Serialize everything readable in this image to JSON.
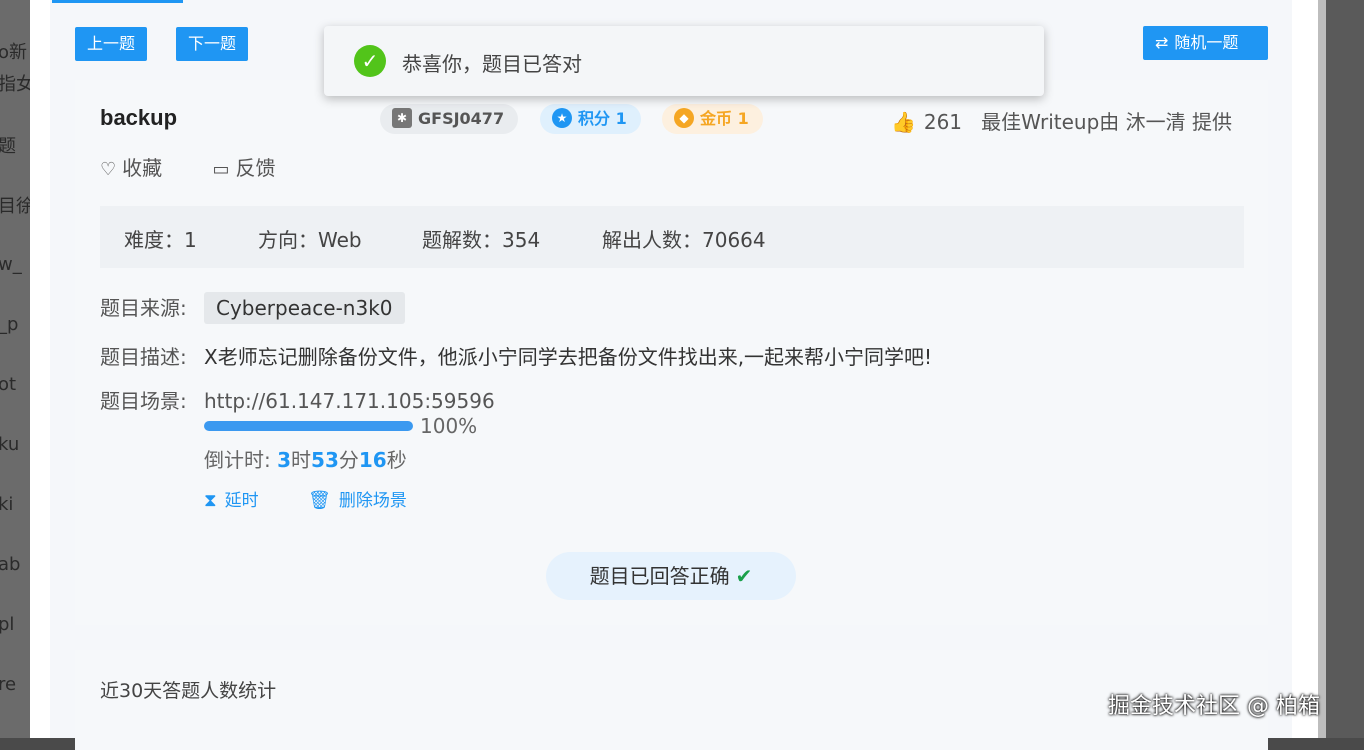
{
  "nav": {
    "prev_label": "上一题",
    "next_label": "下一题",
    "random_label": "随机一题"
  },
  "toast": {
    "message": "恭喜你，题目已答对"
  },
  "challenge": {
    "title": "backup",
    "author": "GFSJ0477",
    "score": "积分 1",
    "coins": "金币 1",
    "likes": "261",
    "best_writeup": "最佳Writeup由 沐一清 提供",
    "favorite_label": "收藏",
    "feedback_label": "反馈"
  },
  "stats": {
    "difficulty": "难度：1",
    "direction": "方向：Web",
    "writeups": "题解数：354",
    "solvers": "解出人数：70664"
  },
  "details": {
    "source_label": "题目来源:",
    "source_value": "Cyberpeace-n3k0",
    "desc_label": "题目描述:",
    "desc_value": "X老师忘记删除备份文件，他派小宁同学去把备份文件找出来,一起来帮小宁同学吧!",
    "scene_label": "题目场景:",
    "scene_url": "http://61.147.171.105:59596",
    "progress_percent": 100,
    "progress_text": "100%",
    "countdown_prefix": "倒计时: ",
    "countdown_h": "3",
    "countdown_h_unit": "时",
    "countdown_m": "53",
    "countdown_m_unit": "分",
    "countdown_s": "16",
    "countdown_s_unit": "秒",
    "extend_label": "延时",
    "delete_label": "删除场景"
  },
  "answered_label": "题目已回答正确",
  "chart_section_title": "近30天答题人数统计",
  "watermark": "掘金技术社区 @ 柏箱",
  "background_fragments": [
    "o新",
    "指女",
    "题",
    "目徐",
    "w_",
    "_p",
    "ot",
    "ku",
    "ki",
    "ab",
    "pl",
    "re"
  ],
  "colors": {
    "accent": "#1f96f3",
    "success": "#52c41a",
    "coin": "#f5a623"
  }
}
